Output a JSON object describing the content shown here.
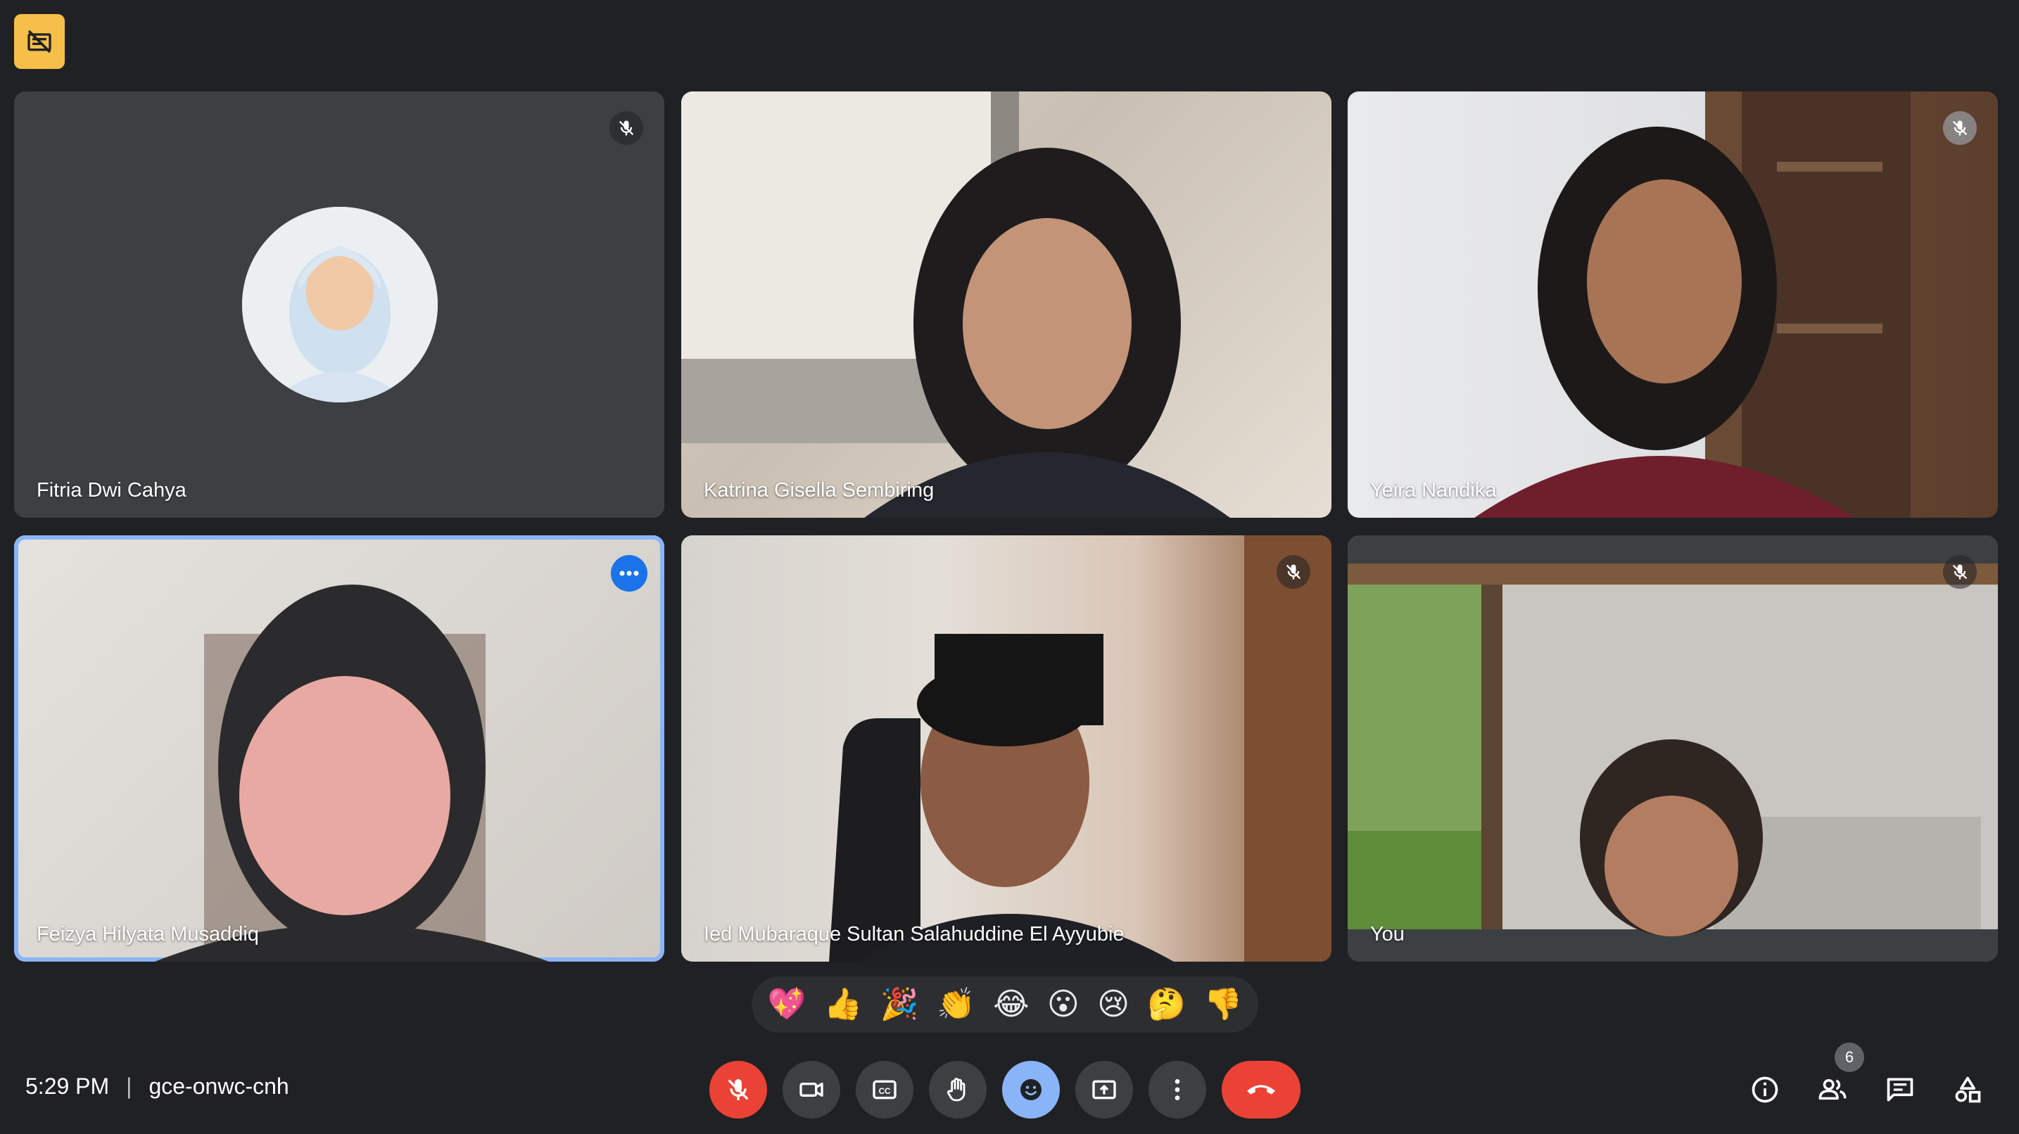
{
  "recording_badge": {
    "icon": "no-camera-icon"
  },
  "tiles": [
    {
      "name": "Fitria Dwi Cahya",
      "video": false,
      "mic_muted": true
    },
    {
      "name": "Katrina Gisella Sembiring",
      "video": true,
      "mic_muted": false
    },
    {
      "name": "Yeira Nandika",
      "video": true,
      "mic_muted": true
    },
    {
      "name": "Feizya Hilyata Musaddiq",
      "video": true,
      "active_speaker": true
    },
    {
      "name": "Ied Mubaraque Sultan Salahuddine El Ayyubie",
      "video": true,
      "mic_muted": true
    },
    {
      "name": "You",
      "video": true,
      "mic_muted": true
    }
  ],
  "reactions": [
    "💖",
    "👍",
    "🎉",
    "👏",
    "😂",
    "😮",
    "😢",
    "🤔",
    "👎"
  ],
  "meeting": {
    "time": "5:29 PM",
    "separator": "|",
    "code": "gce-onwc-cnh"
  },
  "controls": {
    "mic": "mic-off-icon",
    "camera": "camera-icon",
    "captions": "closed-captions-icon",
    "raise_hand": "raise-hand-icon",
    "reactions": "emoji-icon",
    "present": "present-screen-icon",
    "more": "more-options-icon",
    "leave": "leave-call-icon"
  },
  "right_controls": {
    "people_count": "6",
    "icons": [
      "info-icon",
      "people-icon",
      "chat-icon",
      "activities-icon"
    ]
  },
  "colors": {
    "background": "#202124",
    "tile": "#3c4043",
    "accent": "#8ab4f8",
    "danger": "#ea4335",
    "badge": "#f6bf49"
  }
}
